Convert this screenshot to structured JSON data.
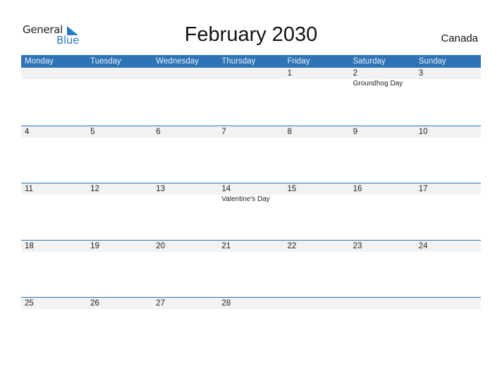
{
  "logo": {
    "line1": "General",
    "line2": "Blue",
    "brand_color": "#2a7ac0"
  },
  "header": {
    "title": "February 2030",
    "country": "Canada"
  },
  "weekdays": [
    "Monday",
    "Tuesday",
    "Wednesday",
    "Thursday",
    "Friday",
    "Saturday",
    "Sunday"
  ],
  "weeks": [
    {
      "days": [
        "",
        "",
        "",
        "",
        "1",
        "2",
        "3"
      ],
      "events": [
        "",
        "",
        "",
        "",
        "",
        "Groundhog Day",
        ""
      ]
    },
    {
      "days": [
        "4",
        "5",
        "6",
        "7",
        "8",
        "9",
        "10"
      ],
      "events": [
        "",
        "",
        "",
        "",
        "",
        "",
        ""
      ]
    },
    {
      "days": [
        "11",
        "12",
        "13",
        "14",
        "15",
        "16",
        "17"
      ],
      "events": [
        "",
        "",
        "",
        "Valentine's Day",
        "",
        "",
        ""
      ]
    },
    {
      "days": [
        "18",
        "19",
        "20",
        "21",
        "22",
        "23",
        "24"
      ],
      "events": [
        "",
        "",
        "",
        "",
        "",
        "",
        ""
      ]
    },
    {
      "days": [
        "25",
        "26",
        "27",
        "28",
        "",
        "",
        ""
      ],
      "events": [
        "",
        "",
        "",
        "",
        "",
        "",
        ""
      ]
    }
  ],
  "colors": {
    "header_bg": "#2e74b5",
    "day_band": "#f2f2f2"
  }
}
